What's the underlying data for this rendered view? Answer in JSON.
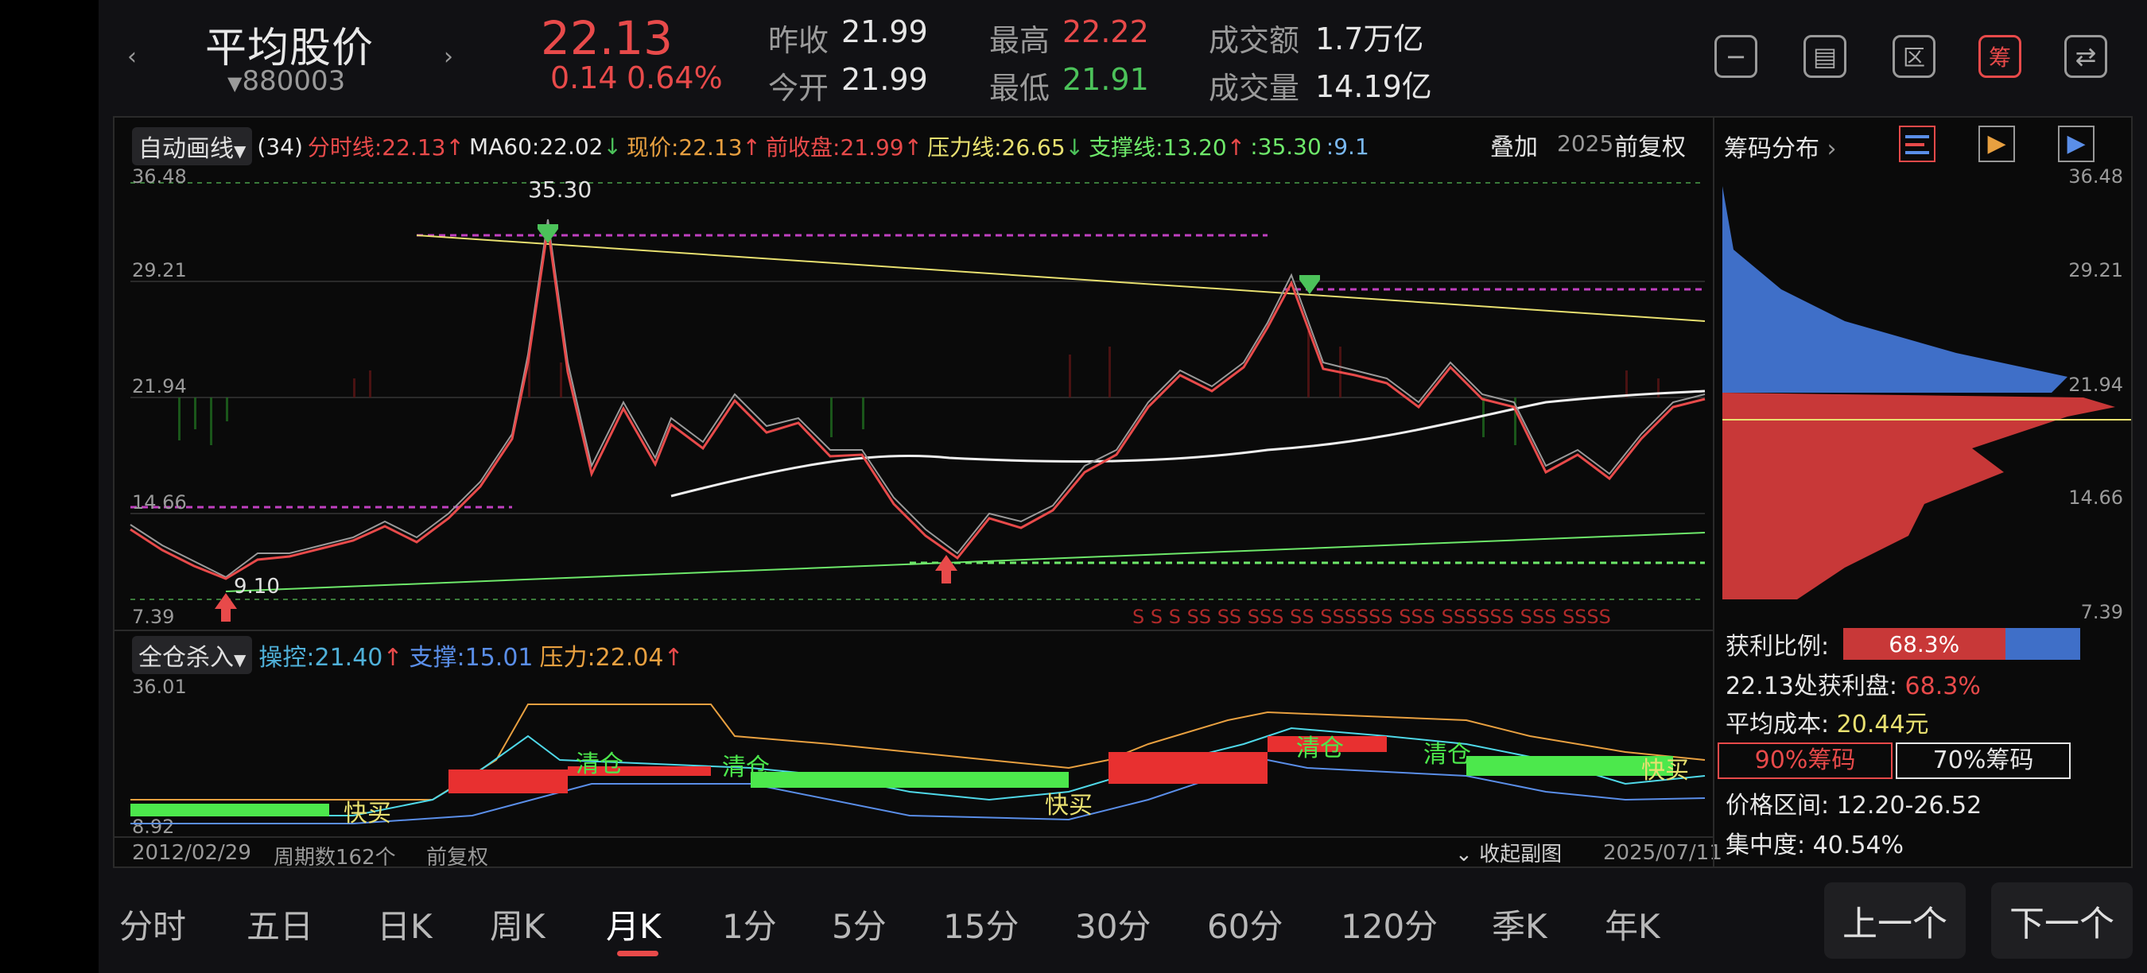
{
  "header": {
    "stock_name": "平均股价",
    "stock_code": "880003",
    "price": "22.13",
    "change": "0.14",
    "change_pct": "0.64%",
    "prev_close_label": "昨收",
    "prev_close": "21.99",
    "open_label": "今开",
    "open": "21.99",
    "high_label": "最高",
    "high": "22.22",
    "low_label": "最低",
    "low": "21.91",
    "turnover_label": "成交额",
    "turnover": "1.7万亿",
    "volume_label": "成交量",
    "volume": "14.19亿"
  },
  "toolbar": {
    "auto_draw": "自动画线",
    "period": "(34)",
    "intraday": "分时线:22.13",
    "ma60": "MA60:22.02",
    "current": "现价:22.13",
    "prev_close": "前收盘:21.99",
    "pressure": "压力线:26.65",
    "support": "支撑线:13.20",
    "v1": ":35.30",
    "v2": ":9.1",
    "overlay": "叠加",
    "date_hint": "2025",
    "adjust": "前复权"
  },
  "main_chart": {
    "y_ticks": [
      "36.48",
      "29.21",
      "21.94",
      "14.66",
      "7.39"
    ],
    "peak_label": "35.30",
    "low_label": "9.10",
    "s_markers": "S S S SS SS SSS SS SSSSSS SSS SSSSSS SSS SSSS"
  },
  "sub_chart": {
    "indicator": "全仓杀入",
    "control": "操控:21.40",
    "support": "支撑:15.01",
    "pressure": "压力:22.04",
    "y_top": "36.01",
    "y_bottom": "8.92",
    "labels": [
      "快买",
      "清仓",
      "清仓",
      "快买",
      "清仓",
      "清仓",
      "快买"
    ]
  },
  "footer": {
    "start_date": "2012/02/29",
    "periods": "周期数162个",
    "adjust": "前复权",
    "collapse": "收起副图",
    "end_date": "2025/07/11"
  },
  "chip_panel": {
    "title": "筹码分布",
    "y_ticks": [
      "36.48",
      "29.21",
      "21.94",
      "14.66",
      "7.39"
    ],
    "profit_ratio_label": "获利比例:",
    "profit_ratio": "68.3%",
    "profit_at_label": "22.13处获利盘:",
    "profit_at": "68.3%",
    "avg_cost_label": "平均成本:",
    "avg_cost": "20.44元",
    "btn_90": "90%筹码",
    "btn_70": "70%筹码",
    "range": "价格区间: 12.20-26.52",
    "concentration": "集中度: 40.54%"
  },
  "tabs": [
    "分时",
    "五日",
    "日K",
    "周K",
    "月K",
    "1分",
    "5分",
    "15分",
    "30分",
    "60分",
    "120分",
    "季K",
    "年K"
  ],
  "active_tab": "月K",
  "nav_buttons": {
    "prev": "上一个",
    "next": "下一个"
  },
  "colors": {
    "up": "#e84a4a",
    "down": "#4cc25a",
    "ma60": "#ffffff",
    "pressure": "#e8e070",
    "support": "#6ee86a",
    "dash": "#c040c0"
  }
}
